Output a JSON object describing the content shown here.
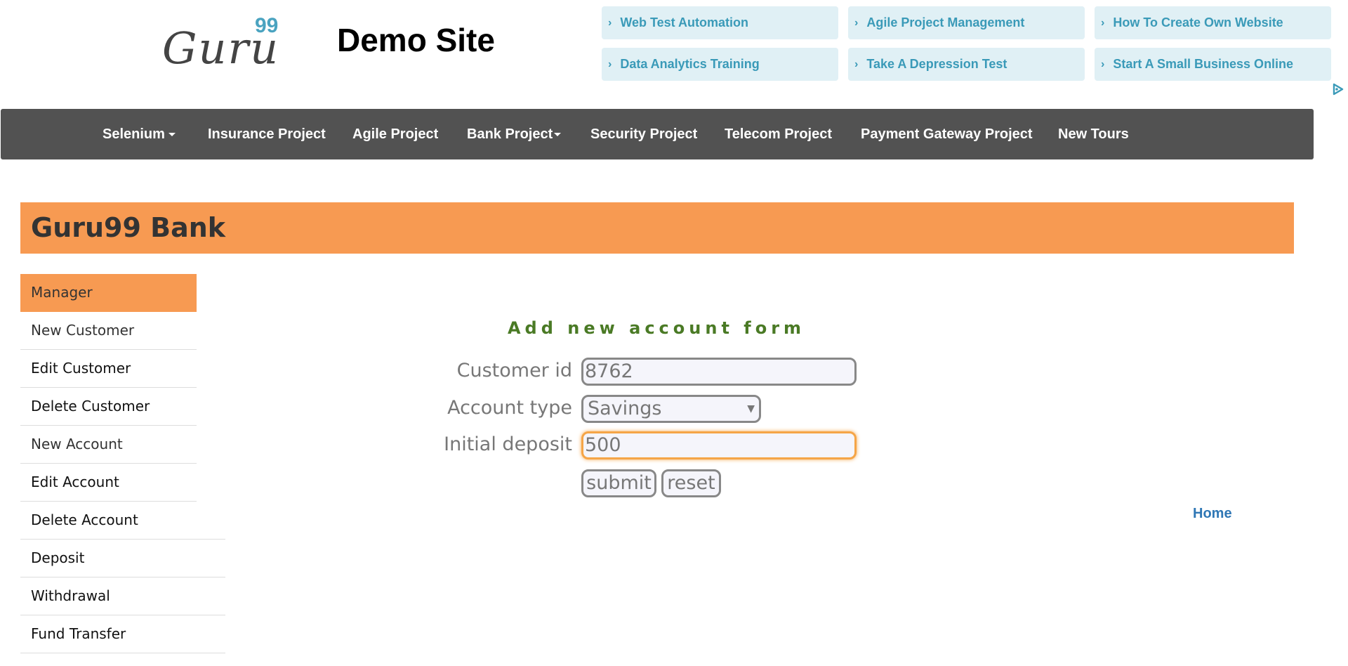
{
  "header": {
    "logo_text": "Guru",
    "logo_sup": "99",
    "site_title": "Demo Site"
  },
  "ads": [
    {
      "label": "Web Test Automation"
    },
    {
      "label": "Agile Project Management"
    },
    {
      "label": "How To Create Own Website"
    },
    {
      "label": "Data Analytics Training"
    },
    {
      "label": "Take A Depression Test"
    },
    {
      "label": "Start A Small Business Online"
    }
  ],
  "ad_chevron": "›",
  "nav": {
    "items": [
      {
        "label": "Selenium",
        "dropdown": true
      },
      {
        "label": "Insurance Project"
      },
      {
        "label": "Agile Project"
      },
      {
        "label": "Bank Project",
        "dropdown": true
      },
      {
        "label": "Security Project"
      },
      {
        "label": "Telecom Project"
      },
      {
        "label": "Payment Gateway Project"
      },
      {
        "label": "New Tours"
      }
    ]
  },
  "bank": {
    "title": "Guru99 Bank"
  },
  "sidebar": {
    "items": [
      {
        "label": "Manager"
      },
      {
        "label": "New Customer"
      },
      {
        "label": "Edit Customer"
      },
      {
        "label": "Delete Customer"
      },
      {
        "label": "New Account"
      },
      {
        "label": "Edit Account"
      },
      {
        "label": "Delete Account"
      },
      {
        "label": "Deposit"
      },
      {
        "label": "Withdrawal"
      },
      {
        "label": "Fund Transfer"
      }
    ]
  },
  "form": {
    "heading": "Add new account form",
    "customer_id_label": "Customer id",
    "customer_id_value": "8762",
    "account_type_label": "Account type",
    "account_type_value": "Savings",
    "initial_deposit_label": "Initial deposit",
    "initial_deposit_value": "500",
    "submit_label": "submit",
    "reset_label": "reset"
  },
  "footer": {
    "home_label": "Home"
  },
  "colors": {
    "accent_orange": "#f79a52",
    "nav_bg": "#525252",
    "link_blue": "#2f77b5",
    "heading_green": "#4a7a25",
    "ad_bg": "#e0f0f5",
    "ad_text": "#3a9ab8"
  }
}
